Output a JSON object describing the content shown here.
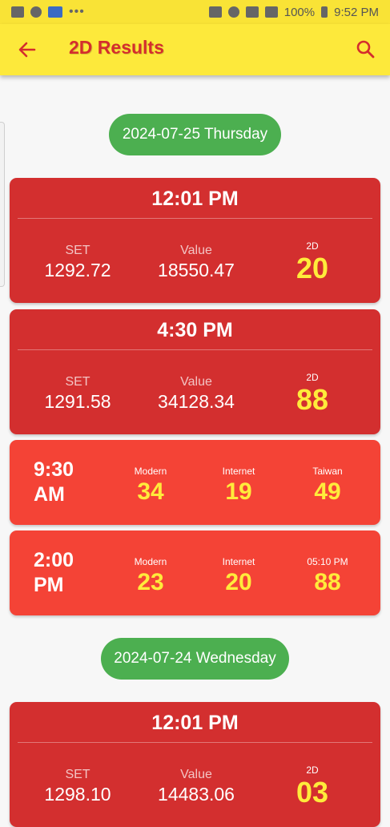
{
  "status_bar": {
    "dots": "•••",
    "battery": "100%",
    "time": "9:52 PM"
  },
  "app_bar": {
    "title": "2D Results",
    "back_icon": "arrow-left-icon",
    "search_icon": "search-icon"
  },
  "colors": {
    "app_bar": "#fde93b",
    "title": "#d42d2d",
    "date_pill": "#4caf50",
    "card_dark": "#d32f2f",
    "card_light": "#f44336",
    "highlight": "#ffeb3b"
  },
  "days": [
    {
      "date": "2024-07-25 Thursday",
      "sessions": [
        {
          "time": "12:01 PM",
          "set_label": "SET",
          "set": "1292.72",
          "value_label": "Value",
          "value": "18550.47",
          "twod_label": "2D",
          "twod": "20"
        },
        {
          "time": "4:30 PM",
          "set_label": "SET",
          "set": "1291.58",
          "value_label": "Value",
          "value": "34128.34",
          "twod_label": "2D",
          "twod": "88"
        }
      ],
      "extras": [
        {
          "time_line1": "9:30",
          "time_line2": "AM",
          "cols": [
            {
              "label": "Modern",
              "value": "34"
            },
            {
              "label": "Internet",
              "value": "19"
            },
            {
              "label": "Taiwan",
              "value": "49"
            }
          ]
        },
        {
          "time_line1": "2:00",
          "time_line2": "PM",
          "cols": [
            {
              "label": "Modern",
              "value": "23"
            },
            {
              "label": "Internet",
              "value": "20"
            },
            {
              "label": "05:10 PM",
              "value": "88"
            }
          ]
        }
      ]
    },
    {
      "date": "2024-07-24 Wednesday",
      "sessions": [
        {
          "time": "12:01 PM",
          "set_label": "SET",
          "set": "1298.10",
          "value_label": "Value",
          "value": "14483.06",
          "twod_label": "2D",
          "twod": "03"
        }
      ]
    }
  ]
}
